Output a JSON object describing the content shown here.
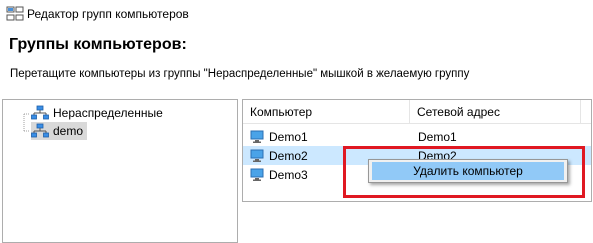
{
  "window": {
    "title": "Редактор групп компьютеров",
    "icon": "group-editor-icon"
  },
  "header": {
    "heading": "Группы компьютеров:",
    "instruction": "Перетащите компьютеры из группы \"Нераспределенные\" мышкой в желаемую группу"
  },
  "tree": {
    "items": [
      {
        "label": "Нераспределенные",
        "icon": "network-group-icon",
        "selected": false
      },
      {
        "label": "demo",
        "icon": "network-group-icon",
        "selected": true
      }
    ]
  },
  "list": {
    "columns": [
      "Компьютер",
      "Сетевой адрес"
    ],
    "rows": [
      {
        "computer": "Demo1",
        "address": "Demo1",
        "icon": "computer-icon",
        "selected": false
      },
      {
        "computer": "Demo2",
        "address": "Demo2",
        "icon": "computer-icon",
        "selected": true
      },
      {
        "computer": "Demo3",
        "address": "",
        "icon": "computer-icon",
        "selected": false
      }
    ]
  },
  "context_menu": {
    "items": [
      "Удалить компьютер"
    ]
  },
  "colors": {
    "selection": "#cce8ff",
    "menu_highlight": "#91c9f7",
    "annotation_frame": "#e01822"
  }
}
